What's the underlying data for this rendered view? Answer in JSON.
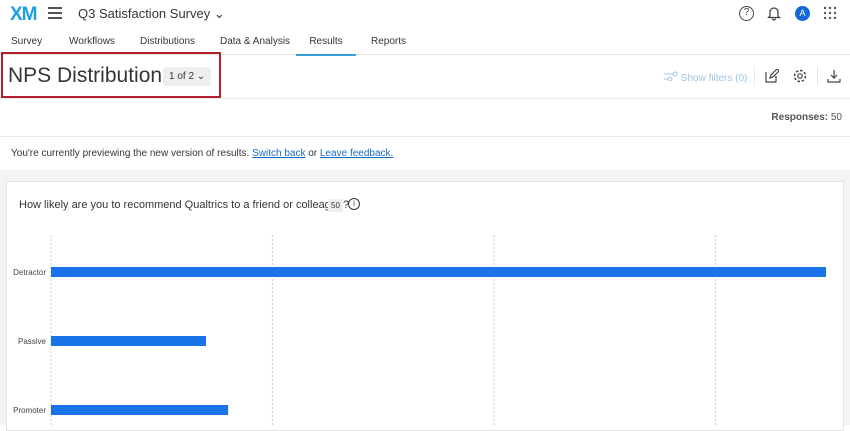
{
  "header": {
    "logo": "XM",
    "project": "Q3 Satisfaction Survey ⌄",
    "help": "?",
    "bell": "🔔",
    "avatar": "A",
    "apps": "⋮⋮⋮"
  },
  "tabs": [
    "Survey",
    "Workflows",
    "Distributions",
    "Data & Analysis",
    "Results",
    "Reports"
  ],
  "page": {
    "title": "NPS Distribution",
    "pager": "1 of 2 ⌄",
    "show_filters": "Show filters (0)",
    "responses_label": "Responses:",
    "responses_value": "50"
  },
  "notice": {
    "text": "You're currently previewing the new version of results. ",
    "switch_back": "Switch back",
    "or": " or ",
    "leave_feedback": "Leave feedback."
  },
  "question": {
    "text": "How likely are you to recommend Qualtrics to a friend or colleague?",
    "count": "50",
    "info": "i"
  },
  "chart_data": {
    "type": "bar",
    "orientation": "horizontal",
    "categories": [
      "Detractor",
      "Passive",
      "Promoter"
    ],
    "values": [
      35,
      7,
      8
    ],
    "xlim": [
      0,
      35
    ],
    "gridlines": [
      0,
      10,
      20,
      30
    ],
    "color": "#1a73e8"
  }
}
